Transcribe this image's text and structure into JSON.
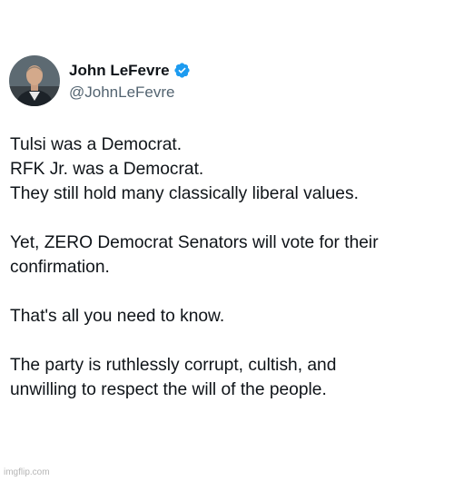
{
  "tweet": {
    "author": {
      "display_name": "John LeFevre",
      "handle": "@JohnLeFevre",
      "verified": true,
      "avatar_icon": "profile-photo"
    },
    "paragraphs": [
      [
        "Tulsi was a Democrat.",
        "RFK Jr. was a Democrat.",
        "They still hold many classically liberal values."
      ],
      [
        "Yet, ZERO Democrat Senators will vote for their",
        "confirmation."
      ],
      [
        "That's all you need to know."
      ],
      [
        "The party is ruthlessly corrupt, cultish, and",
        "unwilling to respect the will of the people."
      ]
    ]
  },
  "watermark": "imgflip.com",
  "colors": {
    "verified_badge": "#1d9bf0",
    "handle": "#536471",
    "text": "#0f1419"
  }
}
